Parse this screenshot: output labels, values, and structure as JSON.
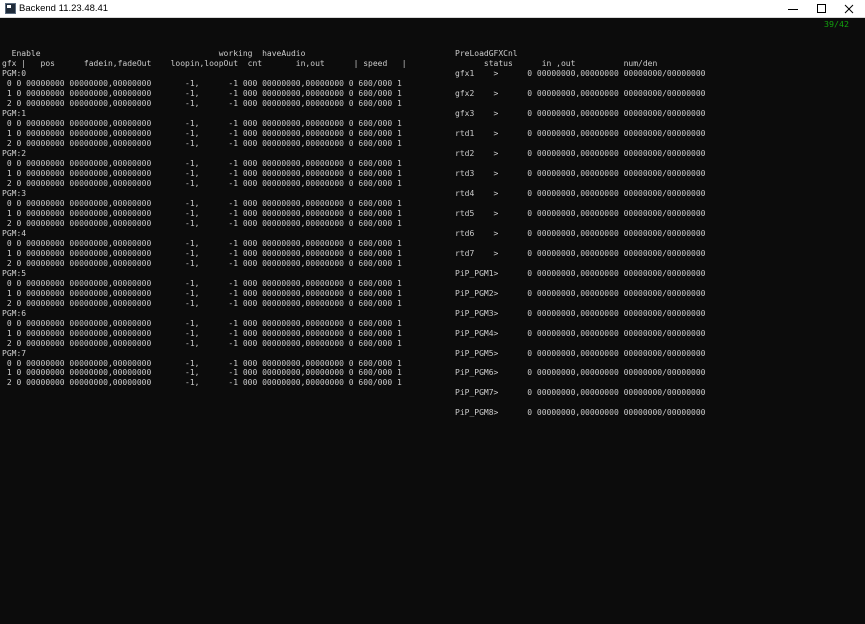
{
  "window": {
    "title": "Backend 11.23.48.41",
    "icons": [
      "app-icon",
      "minimize-icon",
      "maximize-icon",
      "close-icon"
    ]
  },
  "console": {
    "counter": "39/42",
    "left_lines": [
      "",
      "  Enable                                     working  haveAudio",
      "gfx |   pos      fadein,fadeOut    loopin,loopOut  cnt       in,out      | speed   |",
      "PGM:0",
      " 0 0 00000000 00000000,00000000       -1,      -1 000 00000000,00000000 0 600/000 1",
      " 1 0 00000000 00000000,00000000       -1,      -1 000 00000000,00000000 0 600/000 1",
      " 2 0 00000000 00000000,00000000       -1,      -1 000 00000000,00000000 0 600/000 1",
      "PGM:1",
      " 0 0 00000000 00000000,00000000       -1,      -1 000 00000000,00000000 0 600/000 1",
      " 1 0 00000000 00000000,00000000       -1,      -1 000 00000000,00000000 0 600/000 1",
      " 2 0 00000000 00000000,00000000       -1,      -1 000 00000000,00000000 0 600/000 1",
      "PGM:2",
      " 0 0 00000000 00000000,00000000       -1,      -1 000 00000000,00000000 0 600/000 1",
      " 1 0 00000000 00000000,00000000       -1,      -1 000 00000000,00000000 0 600/000 1",
      " 2 0 00000000 00000000,00000000       -1,      -1 000 00000000,00000000 0 600/000 1",
      "PGM:3",
      " 0 0 00000000 00000000,00000000       -1,      -1 000 00000000,00000000 0 600/000 1",
      " 1 0 00000000 00000000,00000000       -1,      -1 000 00000000,00000000 0 600/000 1",
      " 2 0 00000000 00000000,00000000       -1,      -1 000 00000000,00000000 0 600/000 1",
      "PGM:4",
      " 0 0 00000000 00000000,00000000       -1,      -1 000 00000000,00000000 0 600/000 1",
      " 1 0 00000000 00000000,00000000       -1,      -1 000 00000000,00000000 0 600/000 1",
      " 2 0 00000000 00000000,00000000       -1,      -1 000 00000000,00000000 0 600/000 1",
      "PGM:5",
      " 0 0 00000000 00000000,00000000       -1,      -1 000 00000000,00000000 0 600/000 1",
      " 1 0 00000000 00000000,00000000       -1,      -1 000 00000000,00000000 0 600/000 1",
      " 2 0 00000000 00000000,00000000       -1,      -1 000 00000000,00000000 0 600/000 1",
      "PGM:6",
      " 0 0 00000000 00000000,00000000       -1,      -1 000 00000000,00000000 0 600/000 1",
      " 1 0 00000000 00000000,00000000       -1,      -1 000 00000000,00000000 0 600/000 1",
      " 2 0 00000000 00000000,00000000       -1,      -1 000 00000000,00000000 0 600/000 1",
      "PGM:7",
      " 0 0 00000000 00000000,00000000       -1,      -1 000 00000000,00000000 0 600/000 1",
      " 1 0 00000000 00000000,00000000       -1,      -1 000 00000000,00000000 0 600/000 1",
      " 2 0 00000000 00000000,00000000       -1,      -1 000 00000000,00000000 0 600/000 1"
    ],
    "right_lines": [
      "",
      "PreLoadGFXCnl",
      "      status      in ,out          num/den",
      "gfx1    >      0 00000000,00000000 00000000/00000000",
      "",
      "gfx2    >      0 00000000,00000000 00000000/00000000",
      "",
      "gfx3    >      0 00000000,00000000 00000000/00000000",
      "",
      "rtd1    >      0 00000000,00000000 00000000/00000000",
      "",
      "rtd2    >      0 00000000,00000000 00000000/00000000",
      "",
      "rtd3    >      0 00000000,00000000 00000000/00000000",
      "",
      "rtd4    >      0 00000000,00000000 00000000/00000000",
      "",
      "rtd5    >      0 00000000,00000000 00000000/00000000",
      "",
      "rtd6    >      0 00000000,00000000 00000000/00000000",
      "",
      "rtd7    >      0 00000000,00000000 00000000/00000000",
      "",
      "PiP_PGM1>      0 00000000,00000000 00000000/00000000",
      "",
      "PiP_PGM2>      0 00000000,00000000 00000000/00000000",
      "",
      "PiP_PGM3>      0 00000000,00000000 00000000/00000000",
      "",
      "PiP_PGM4>      0 00000000,00000000 00000000/00000000",
      "",
      "PiP_PGM5>      0 00000000,00000000 00000000/00000000",
      "",
      "PiP_PGM6>      0 00000000,00000000 00000000/00000000",
      "",
      "PiP_PGM7>      0 00000000,00000000 00000000/00000000",
      "",
      "PiP_PGM8>      0 00000000,00000000 00000000/00000000"
    ]
  },
  "colors": {
    "console_bg": "#0c0c0c",
    "console_text": "#cccccc",
    "counter_green": "#13a10e"
  }
}
